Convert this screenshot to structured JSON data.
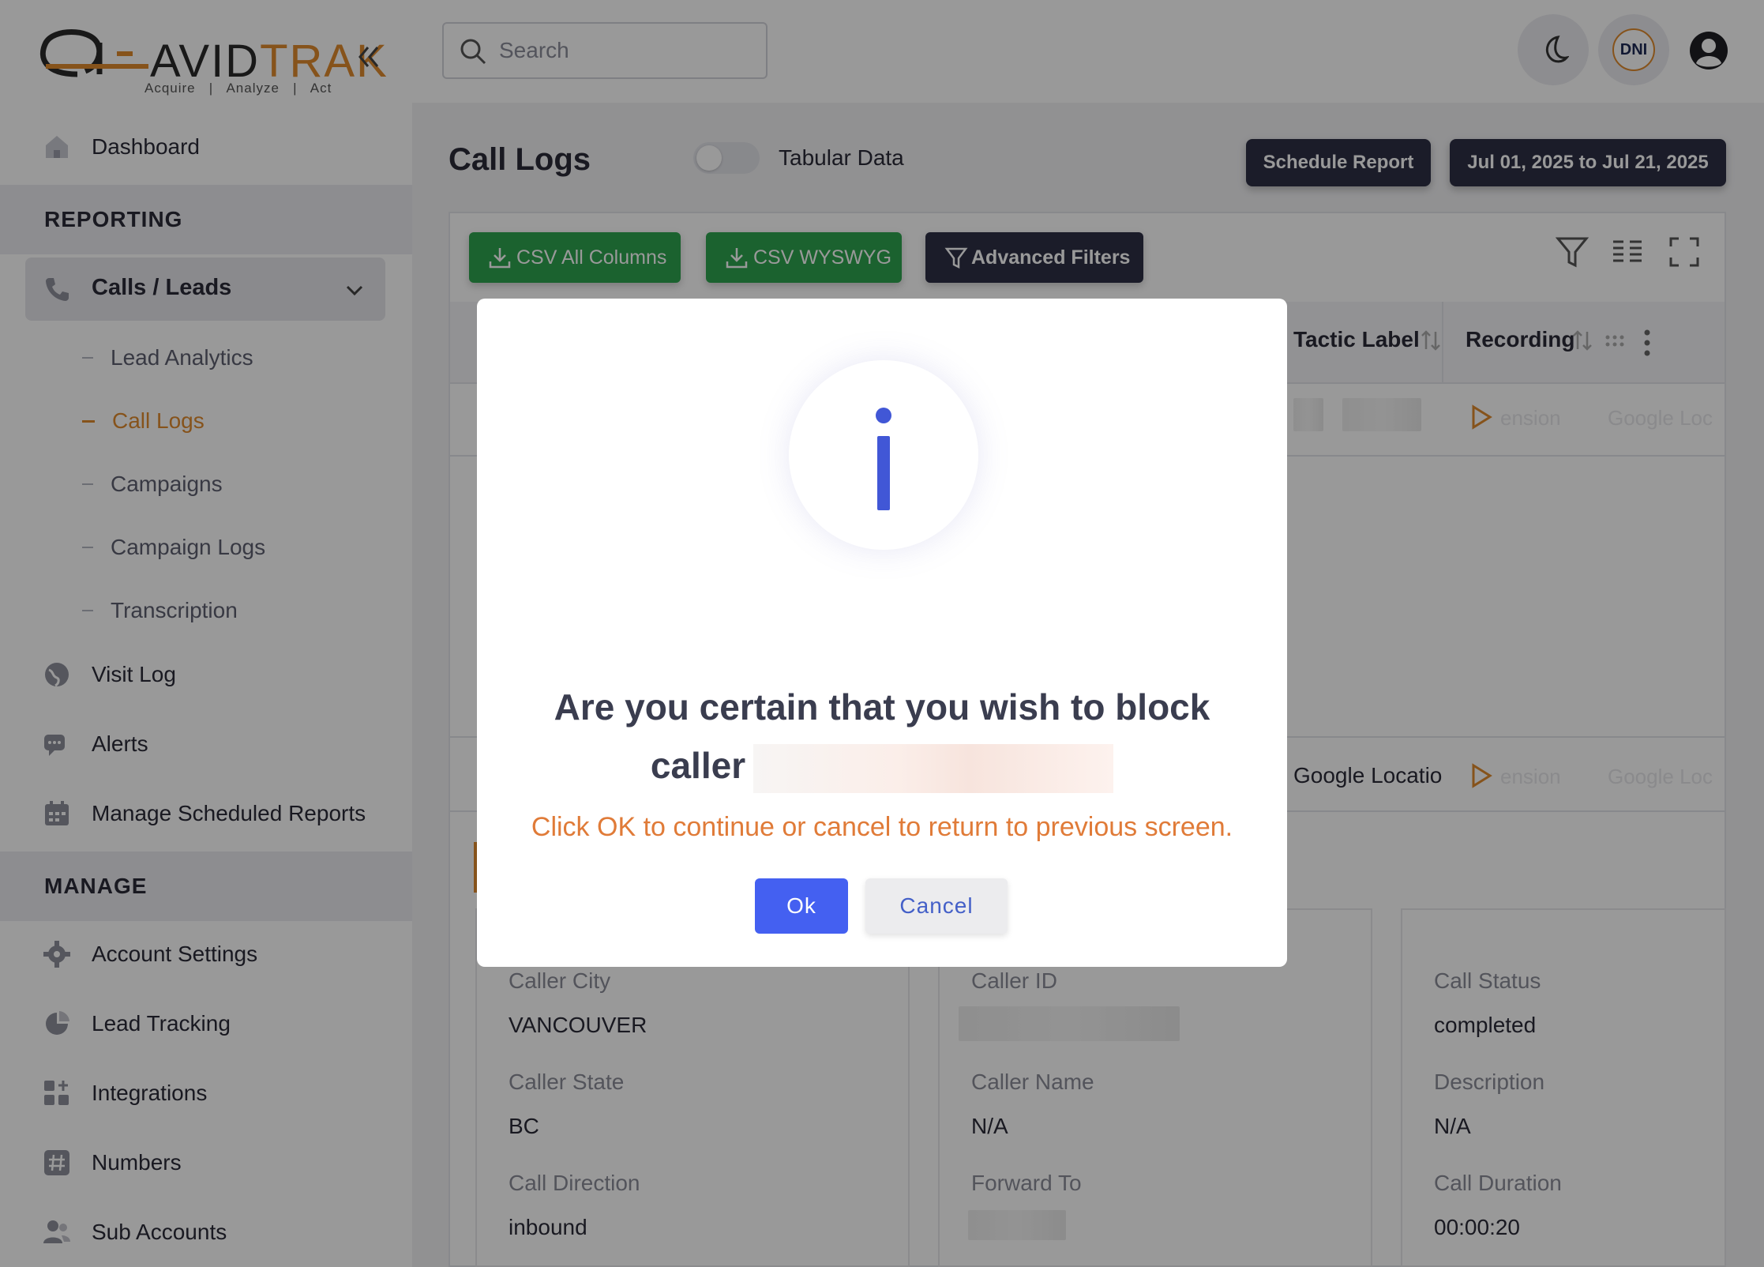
{
  "brand": {
    "logo_text": "AVID",
    "logo_text_accent": "TRAK",
    "tagline": "Acquire   |   Analyze   |   Act",
    "accent_color": "#e08a2e"
  },
  "sidebar": {
    "dashboard": "Dashboard",
    "reporting_header": "REPORTING",
    "calls_leads": "Calls / Leads",
    "sub_items": [
      "Lead Analytics",
      "Call Logs",
      "Campaigns",
      "Campaign Logs",
      "Transcription"
    ],
    "visit_log": "Visit Log",
    "alerts": "Alerts",
    "scheduled_reports": "Manage Scheduled Reports",
    "manage_header": "MANAGE",
    "account_settings": "Account Settings",
    "lead_tracking": "Lead Tracking",
    "integrations": "Integrations",
    "numbers": "Numbers",
    "sub_accounts": "Sub Accounts"
  },
  "topbar": {
    "search_placeholder": "Search",
    "dni_label": "DNI"
  },
  "page": {
    "title": "Call Logs",
    "toggle_label": "Tabular Data",
    "schedule_report": "Schedule Report",
    "date_range": "Jul 01, 2025 to Jul 21, 2025"
  },
  "toolbar": {
    "csv_all": "CSV All Columns",
    "csv_wysiwyg": "CSV WYSWYG",
    "advanced_filters": "Advanced Filters"
  },
  "table": {
    "columns": [
      "Tactic Label",
      "Recording"
    ],
    "row2_tactic": "Google Locatio",
    "faint_cells": [
      "ension",
      "Google Loc"
    ]
  },
  "details": {
    "col1": [
      {
        "label": "Caller City",
        "value": "VANCOUVER"
      },
      {
        "label": "Caller State",
        "value": "BC"
      },
      {
        "label": "Call Direction",
        "value": "inbound"
      }
    ],
    "col2": [
      {
        "label": "Caller ID",
        "value": ""
      },
      {
        "label": "Caller Name",
        "value": "N/A"
      },
      {
        "label": "Forward To",
        "value": ""
      }
    ],
    "col3": [
      {
        "label": "Call Status",
        "value": "completed"
      },
      {
        "label": "Description",
        "value": "N/A"
      },
      {
        "label": "Call Duration",
        "value": "00:00:20"
      }
    ]
  },
  "modal": {
    "title_line1": "Are you certain that you wish to block",
    "title_line2": "caller",
    "message": "Click OK to continue or cancel to return to previous screen.",
    "ok_label": "Ok",
    "cancel_label": "Cancel",
    "info_color": "#4157d6",
    "message_color": "#e07b38"
  }
}
